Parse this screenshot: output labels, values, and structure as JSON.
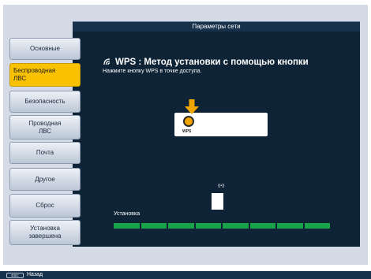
{
  "window": {
    "title": "Параметры сети"
  },
  "sidebar": {
    "items": [
      {
        "label": "Основные",
        "active": false
      },
      {
        "label": "Беспроводная\nЛВС",
        "active": true
      },
      {
        "label": "Безопасность",
        "active": false
      },
      {
        "label": "Проводная\nЛВС",
        "active": false
      },
      {
        "label": "Почта",
        "active": false
      },
      {
        "label": "Другое",
        "active": false
      },
      {
        "label": "Сброс",
        "active": false
      },
      {
        "label": "Установка\nзавершена",
        "active": false
      }
    ]
  },
  "main": {
    "wps_title": "WPS : Метод установки с помощью кнопки",
    "wps_instruction": "Нажмите кнопку WPS в точке доступа.",
    "wps_button_label": "WPS",
    "ap_signal": "((•))",
    "install_label": "Установка",
    "progress_segments_filled": 8,
    "progress_segments_total": 8
  },
  "footer": {
    "esc_key": "ESC",
    "back_label": "Назад"
  },
  "colors": {
    "accent": "#f9c200",
    "panel": "#0e2336",
    "progress": "#18a34a"
  }
}
